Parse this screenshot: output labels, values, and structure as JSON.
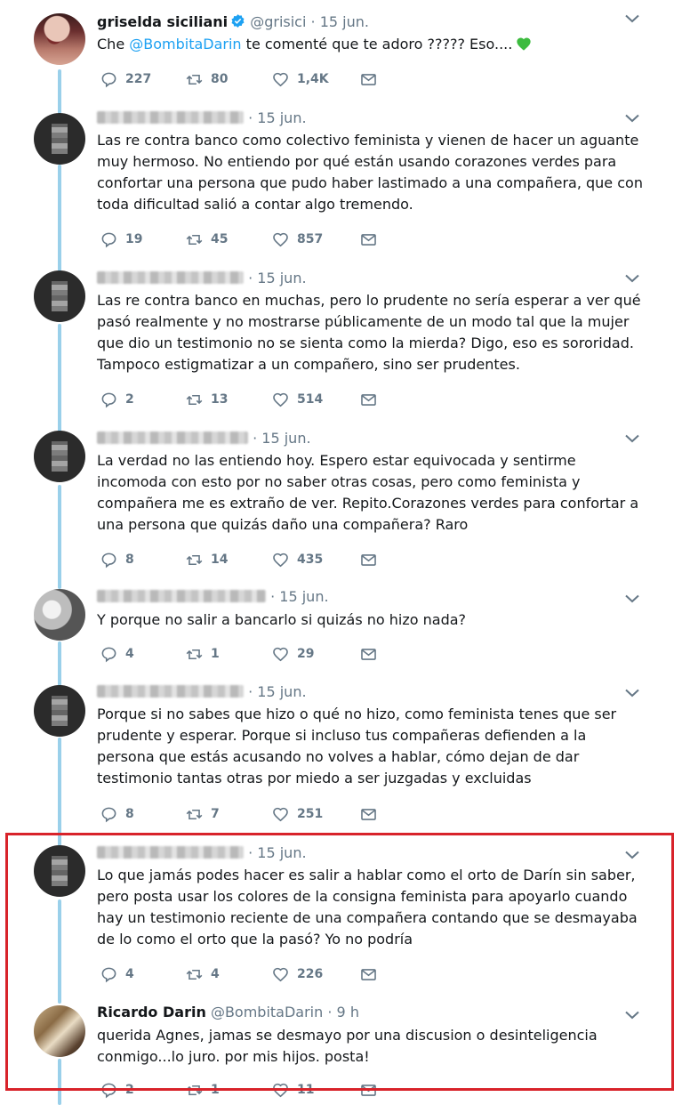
{
  "tweets": [
    {
      "name": "griselda siciliani",
      "verified": true,
      "handle": "@grisici",
      "dot": "·",
      "time": "15 jun.",
      "text_prefix": "Che ",
      "mention": "@BombitaDarin",
      "text_suffix": " te comenté que te adoro ????? Eso....",
      "emoji": "green-heart-icon",
      "reply_count": "227",
      "retweet_count": "80",
      "like_count": "1,4K"
    },
    {
      "name_blurred": true,
      "dot": "·",
      "time": "15 jun.",
      "text": "Las re contra banco como colectivo feminista y vienen de hacer un aguante muy hermoso. No entiendo por qué están usando corazones verdes para confortar una persona que pudo haber lastimado a una compañera, que con toda dificultad salió a contar algo tremendo.",
      "reply_count": "19",
      "retweet_count": "45",
      "like_count": "857"
    },
    {
      "name_blurred": true,
      "dot": "·",
      "time": "15 jun.",
      "text": "Las re contra banco en muchas, pero lo prudente no sería esperar a ver qué pasó realmente y no mostrarse públicamente de un modo tal que la mujer que dio un testimonio no se sienta como la mierda? Digo, eso es sororidad. Tampoco estigmatizar a un compañero, sino ser prudentes.",
      "reply_count": "2",
      "retweet_count": "13",
      "like_count": "514"
    },
    {
      "name_blurred": true,
      "dot": "·",
      "time": "15 jun.",
      "text": "La verdad no las entiendo hoy. Espero estar equivocada y sentirme incomoda con esto por no saber otras cosas, pero como feminista y compañera me es extraño de ver. Repito.Corazones verdes para confortar a una persona que quizás daño una compañera? Raro",
      "reply_count": "8",
      "retweet_count": "14",
      "like_count": "435"
    },
    {
      "name_blurred": true,
      "dot": "·",
      "time": "15 jun.",
      "text": "Y porque no salir a bancarlo si quizás no hizo nada?",
      "reply_count": "4",
      "retweet_count": "1",
      "like_count": "29"
    },
    {
      "name_blurred": true,
      "dot": "·",
      "time": "15 jun.",
      "text": "Porque si no sabes que hizo o qué no hizo, como feminista tenes que ser prudente y esperar. Porque si incluso tus compañeras defienden a la persona que estás acusando no volves a hablar, cómo dejan de dar testimonio tantas otras por miedo a ser juzgadas y excluidas",
      "reply_count": "8",
      "retweet_count": "7",
      "like_count": "251"
    },
    {
      "name_blurred": true,
      "dot": "·",
      "time": "15 jun.",
      "text": "Lo que jamás podes hacer es salir a hablar como el orto de Darín sin saber, pero posta usar los colores de la consigna feminista para apoyarlo cuando hay un testimonio reciente de una compañera contando que se desmayaba de lo como el orto que la pasó? Yo no podría",
      "reply_count": "4",
      "retweet_count": "4",
      "like_count": "226"
    },
    {
      "name": "Ricardo Darin",
      "handle": "@BombitaDarin",
      "dot": "·",
      "time": "9 h",
      "text": "querida Agnes, jamas se desmayo por una discusion o desinteligencia conmigo...lo juro. por mis hijos. posta!",
      "reply_count": "2",
      "retweet_count": "1",
      "like_count": "11"
    }
  ],
  "colors": {
    "thread_line": "#9ad0ea",
    "highlight_border": "#d8232a",
    "mention": "#1da1f2",
    "meta_text": "#657786",
    "green_heart": "#3dbb3f"
  }
}
